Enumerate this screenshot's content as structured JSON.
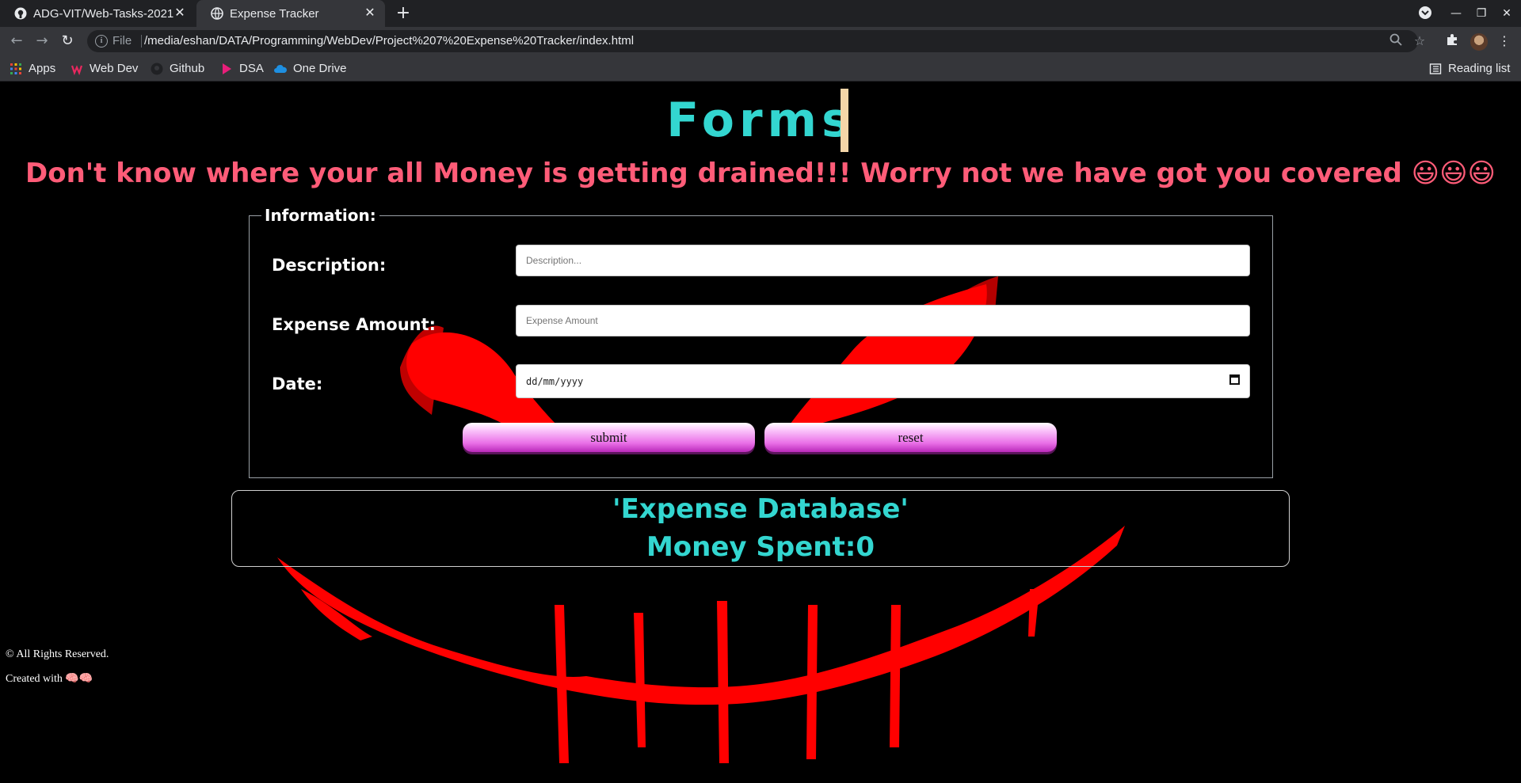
{
  "browser": {
    "tabs": [
      {
        "label": "ADG-VIT/Web-Tasks-2021",
        "icon": "github-icon"
      },
      {
        "label": "Expense Tracker",
        "icon": "globe-icon"
      }
    ],
    "address": {
      "file_label": "File",
      "url": "/media/eshan/DATA/Programming/WebDev/Project%207%20Expense%20Tracker/index.html"
    },
    "bookmarks": [
      {
        "label": "Apps"
      },
      {
        "label": "Web Dev"
      },
      {
        "label": "Github"
      },
      {
        "label": "DSA"
      },
      {
        "label": "One Drive"
      }
    ],
    "reading_list": "Reading list"
  },
  "page": {
    "title": "Forms",
    "tagline": "Don't know where your all Money is getting drained!!! Worry not we have got you covered 😃😃😃",
    "form": {
      "legend": "Information:",
      "fields": [
        {
          "label": "Description:",
          "placeholder": "Description..."
        },
        {
          "label": "Expense Amount:",
          "placeholder": "Expense Amount"
        },
        {
          "label": "Date:",
          "placeholder": "dd/mm/yyyy"
        }
      ],
      "submit_label": "submit",
      "reset_label": "reset"
    },
    "database": {
      "heading": "'Expense Database'",
      "money_spent": "Money Spent:0"
    },
    "footer": {
      "rights": "© All Rights Reserved.",
      "created": "Created with 🧠🧠"
    }
  },
  "colors": {
    "title": "#33d6d0",
    "tagline": "#ff5c78",
    "background_art": "#ff0000",
    "button_gradient": "#e96fe7"
  }
}
